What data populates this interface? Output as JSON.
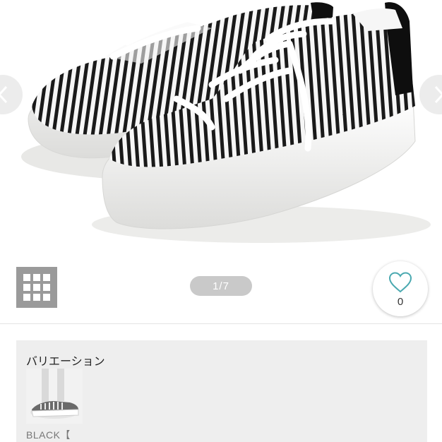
{
  "gallery": {
    "image_counter": "1/7",
    "like_count": "0"
  },
  "variation": {
    "title": "バリエーション",
    "items": [
      {
        "label": "BLACK【"
      }
    ]
  },
  "colors": {
    "shoe_stripe_dark": "#1a1a1a",
    "shoe_stripe_light": "#f6f6f6",
    "sole": "#f2f2f0",
    "heart_outline": "#4aa9b0",
    "grid_button_bg": "#9a9a9a",
    "counter_pill_bg": "#c9c9c9",
    "variation_panel_bg": "#eeeeee"
  }
}
